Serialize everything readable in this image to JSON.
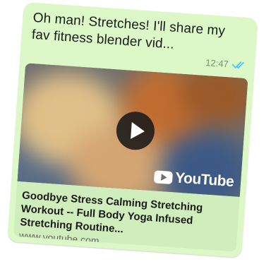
{
  "message": {
    "text": "Oh man! Stretches! I'll share my fav fitness blender vid...",
    "time": "12:47",
    "status_icon": "double-check-read-icon",
    "colors": {
      "bubble": "#dcf8c6",
      "tick": "#4fc3f7"
    }
  },
  "link_preview": {
    "thumbnail": "blurred-video-thumbnail",
    "play_icon": "play-button-icon",
    "brand": "YouTube",
    "title": "Goodbye Stress Calming Stretching Workout -- Full Body Yoga Infused Stretching Routine...",
    "domain": "www.youtube.com"
  }
}
